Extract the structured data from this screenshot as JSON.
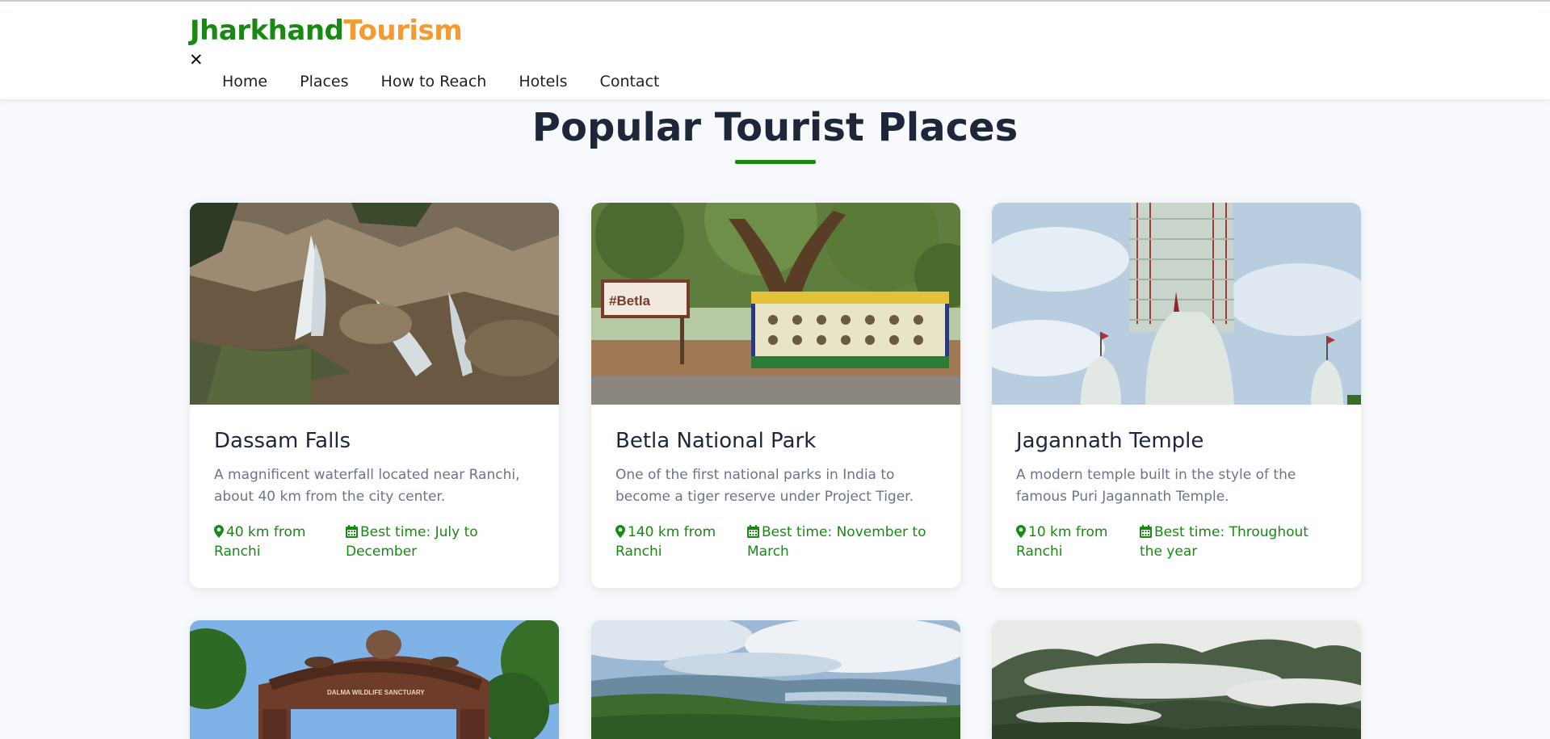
{
  "brand": {
    "part1": "Jharkhand",
    "part2": "Tourism",
    "primary_color": "#188a13",
    "accent_color": "#f39a33"
  },
  "nav": {
    "close_symbol": "✕",
    "items": [
      {
        "label": "Home"
      },
      {
        "label": "Places"
      },
      {
        "label": "How to Reach"
      },
      {
        "label": "Hotels"
      },
      {
        "label": "Contact"
      }
    ]
  },
  "section": {
    "title": "Popular Tourist Places"
  },
  "places": [
    {
      "name": "Dassam Falls",
      "description": "A magnificent waterfall located near Ranchi, about 40 km from the city center.",
      "distance": "40 km from Ranchi",
      "best_time": "Best time: July to December",
      "image_icon": "waterfall-photo"
    },
    {
      "name": "Betla National Park",
      "description": "One of the first national parks in India to become a tiger reserve under Project Tiger.",
      "distance": "140 km from Ranchi",
      "best_time": "Best time: November to March",
      "image_icon": "national-park-photo",
      "sign_text": "#Betla"
    },
    {
      "name": "Jagannath Temple",
      "description": "A modern temple built in the style of the famous Puri Jagannath Temple.",
      "distance": "10 km from Ranchi",
      "best_time": "Best time: Throughout the year",
      "image_icon": "temple-photo"
    },
    {
      "image_icon": "wildlife-sanctuary-gate-photo",
      "sign_text": "DALMA WILDLIFE SANCTUARY"
    },
    {
      "image_icon": "valley-lake-photo"
    },
    {
      "image_icon": "misty-forest-photo"
    }
  ],
  "icons": {
    "distance": "map-marker-icon",
    "best_time": "calendar-icon"
  }
}
